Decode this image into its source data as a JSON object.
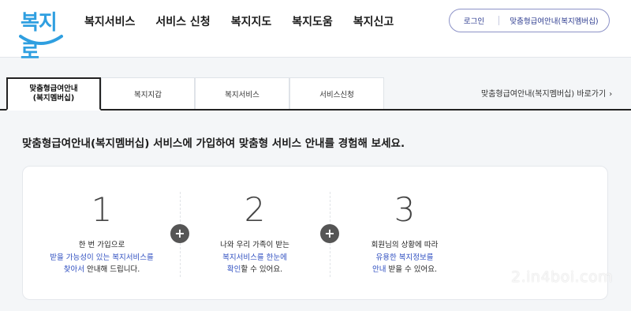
{
  "logo": {
    "text": "복지로"
  },
  "nav": [
    "복지서비스",
    "서비스 신청",
    "복지지도",
    "복지도움",
    "복지신고"
  ],
  "util": {
    "login": "로그인",
    "member": "맞춤형급여안내(복지멤버십)"
  },
  "tabs": [
    {
      "label_line1": "맞춤형급여안내",
      "label_line2": "(복지멤버십)"
    },
    {
      "label": "복지지갑"
    },
    {
      "label": "복지서비스"
    },
    {
      "label": "서비스신청"
    }
  ],
  "shortcut": {
    "label": "맞춤형급여안내(복지멤버십) 바로가기",
    "chevron": "›"
  },
  "headline": "맞춤형급여안내(복지멤버십) 서비스에 가입하여 맞춤형 서비스 안내를 경험해 보세요.",
  "steps": [
    {
      "number": "1",
      "line1": "한 번 가입으로",
      "line2_hl": "받을 가능성이 있는 복지서비스를",
      "line3_hl": "찾아서",
      "line3_rest": " 안내해 드립니다."
    },
    {
      "number": "2",
      "line1": "나와 우리 가족이 받는",
      "line2_hl": "복지서비스를 한눈에",
      "line3_hl": "확인",
      "line3_rest": "할 수 있어요."
    },
    {
      "number": "3",
      "line1": "회원님의 상황에 따라",
      "line2_hl": "유용한 복지정보를",
      "line3_hl": "안내",
      "line3_rest": " 받을 수 있어요."
    }
  ],
  "plus_symbol": "+",
  "watermark": "2.in4boi.com",
  "colors": {
    "accent": "#2f4fc0",
    "logo": "#2f9fe0",
    "util_border": "#8c92c7"
  }
}
